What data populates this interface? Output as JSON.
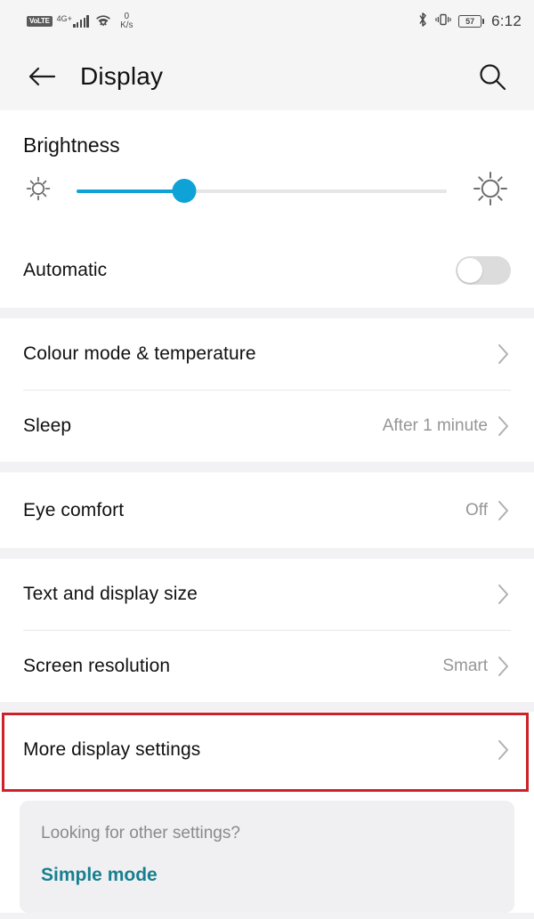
{
  "status_bar": {
    "volte_label": "VoLTE",
    "network_label": "4G+",
    "signal_bars": 5,
    "data_speed_value": "0",
    "data_speed_unit": "K/s",
    "bluetooth_icon": "bluetooth-icon",
    "vibrate_icon": "vibrate-icon",
    "battery_percent": "57",
    "time": "6:12"
  },
  "app_bar": {
    "back_icon": "back-arrow-icon",
    "title": "Display",
    "search_icon": "search-icon"
  },
  "brightness": {
    "title": "Brightness",
    "low_icon": "sun-small-icon",
    "high_icon": "sun-large-icon",
    "slider_percent": 29,
    "accent_color": "#0FA2D6"
  },
  "automatic": {
    "label": "Automatic",
    "enabled": false
  },
  "groups": [
    {
      "rows": [
        {
          "label": "Colour mode & temperature",
          "value": "",
          "chevron": "chevron-right-icon"
        },
        {
          "label": "Sleep",
          "value": "After 1 minute",
          "chevron": "chevron-right-icon"
        }
      ]
    },
    {
      "rows": [
        {
          "label": "Eye comfort",
          "value": "Off",
          "chevron": "chevron-right-icon"
        }
      ]
    },
    {
      "rows": [
        {
          "label": "Text and display size",
          "value": "",
          "chevron": "chevron-right-icon"
        },
        {
          "label": "Screen resolution",
          "value": "Smart",
          "chevron": "chevron-right-icon"
        }
      ]
    },
    {
      "rows": [
        {
          "label": "More display settings",
          "value": "",
          "chevron": "chevron-right-icon"
        }
      ]
    }
  ],
  "highlight": {
    "target": "More display settings",
    "color": "#CC2229"
  },
  "footer": {
    "question": "Looking for other settings?",
    "link_label": "Simple mode",
    "link_color": "#17808F"
  }
}
